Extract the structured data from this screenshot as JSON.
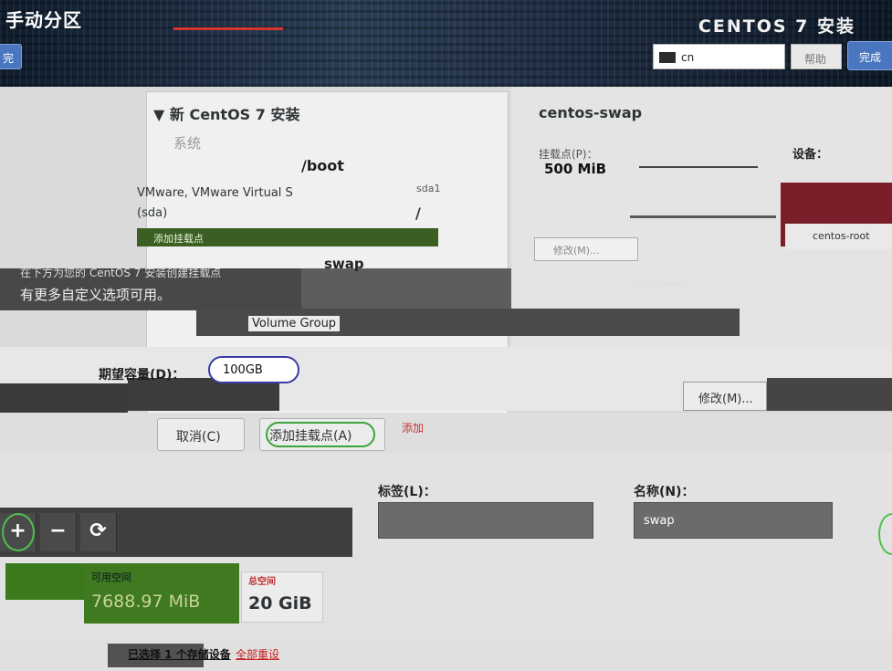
{
  "header": {
    "title": "手动分区",
    "right_title": "CENTOS 7 安装",
    "done_left": "完",
    "done_right": "完成",
    "keyboard": "cn",
    "help": "帮助"
  },
  "tree": {
    "heading": "▼ 新 CentOS 7 安装",
    "system": "系统",
    "boot_mount": "/boot",
    "disk_name": "VMware, VMware Virtual S",
    "disk_short": "sda1",
    "disk_id": "(sda)",
    "root_mount": "/",
    "swap_mount": "swap",
    "green_hint": "添加挂载点"
  },
  "left_hints": {
    "line1": "在下方为您的 CentOS 7 安装创建挂载点",
    "line2": "有更多自定义选项可用。"
  },
  "details": {
    "title": "centos-swap",
    "mount_label": "挂载点(P)：",
    "capacity_value": "500 MiB",
    "device_label": "设备：",
    "vg_name": "centos-root",
    "modify_small": "修改(M)...",
    "vg_device": "centos-swap"
  },
  "dialog": {
    "volume_group": "Volume Group",
    "capacity_label": "期望容量(D)：",
    "capacity_value": "100GB",
    "modify_button": "修改(M)...",
    "cancel_button": "取消(C)",
    "add_button": "添加挂载点(A)",
    "red_note": "添加"
  },
  "bottom": {
    "tag_label": "标签(L)：",
    "name_label": "名称(N)：",
    "name_value": "swap",
    "avail_label": "可用空间",
    "avail_value": "7688.97 MiB",
    "total_label": "总空间",
    "total_value": "20 GiB",
    "storage_link": "已选择 1 个存储设备",
    "reset_link": "全部重设"
  },
  "toolbar": {
    "add": "+",
    "remove": "−",
    "refresh": "⟳"
  }
}
